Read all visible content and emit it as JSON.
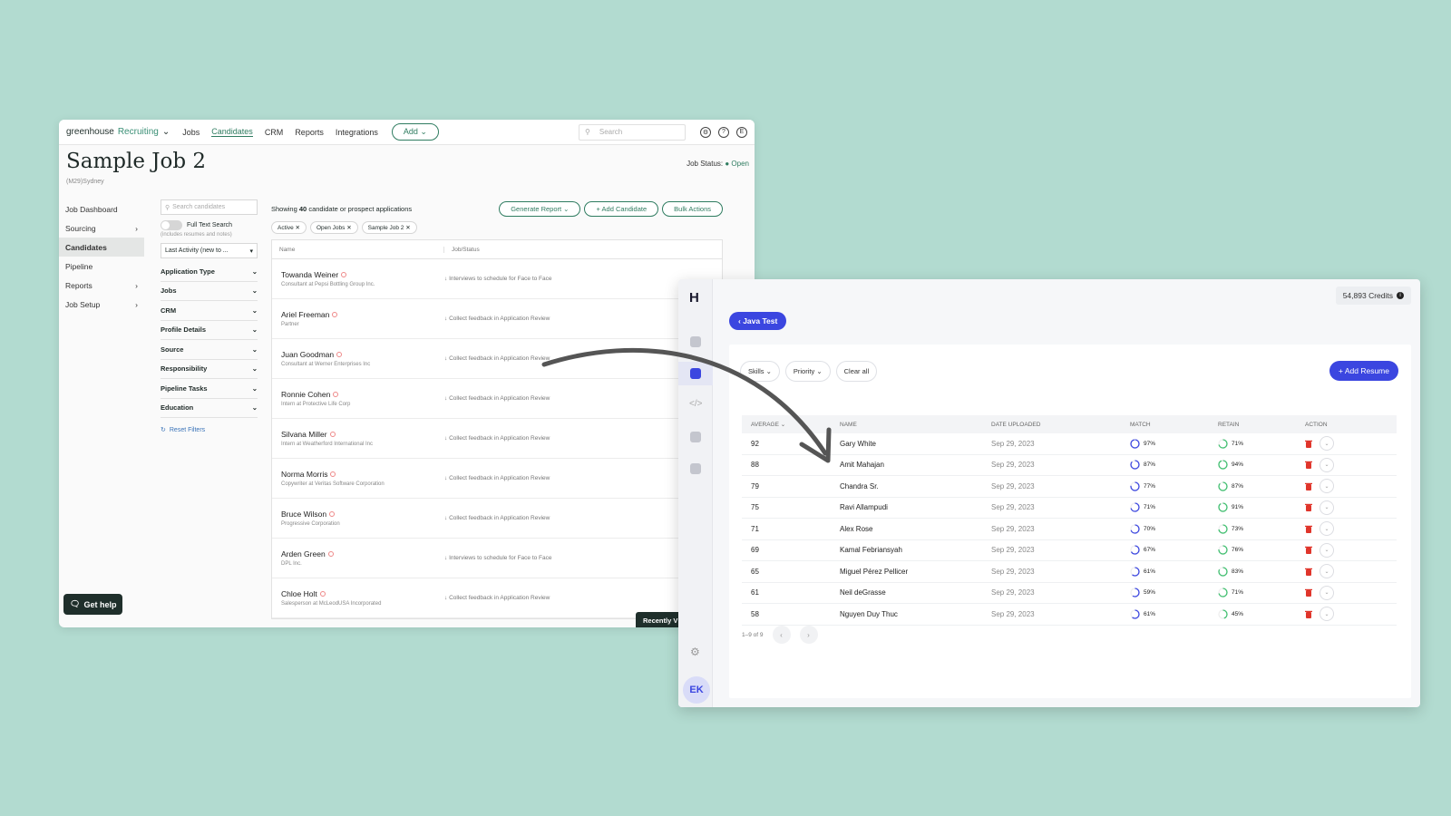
{
  "greenhouse": {
    "logo": "greenhouse",
    "logo_suffix": "Recruiting",
    "nav": [
      "Jobs",
      "Candidates",
      "CRM",
      "Reports",
      "Integrations"
    ],
    "add_button": "Add",
    "search_placeholder": "Search",
    "job_title": "Sample Job 2",
    "job_sub": "(M29)Sydney",
    "job_status_label": "Job Status:",
    "job_status_value": "Open",
    "left_nav": [
      {
        "label": "Job Dashboard",
        "arrow": false
      },
      {
        "label": "Sourcing",
        "arrow": true
      },
      {
        "label": "Candidates",
        "arrow": false
      },
      {
        "label": "Pipeline",
        "arrow": false
      },
      {
        "label": "Reports",
        "arrow": true
      },
      {
        "label": "Job Setup",
        "arrow": true
      }
    ],
    "filter_search_placeholder": "Search candidates",
    "full_text_search": "Full Text Search",
    "full_text_note": "(includes resumes and notes)",
    "sort_label": "Last Activity (new to ...",
    "filter_groups": [
      "Application Type",
      "Jobs",
      "CRM",
      "Profile Details",
      "Source",
      "Responsibility",
      "Pipeline Tasks",
      "Education"
    ],
    "reset_filters": "Reset Filters",
    "showing_prefix": "Showing",
    "showing_count": "40",
    "showing_suffix": "candidate or prospect applications",
    "generate_report": "Generate Report",
    "add_candidate": "+ Add Candidate",
    "bulk_actions": "Bulk Actions",
    "chips": [
      "Active",
      "Open Jobs",
      "Sample Job 2"
    ],
    "col_name": "Name",
    "col_job": "Job/Status",
    "candidates": [
      {
        "name": "Towanda Weiner",
        "company": "Consultant at Pepsi Bottling Group Inc.",
        "status": "Interviews to schedule for Face to Face"
      },
      {
        "name": "Ariel Freeman",
        "company": "Partner",
        "status": "Collect feedback in Application Review"
      },
      {
        "name": "Juan Goodman",
        "company": "Consultant at Werner Enterprises Inc",
        "status": "Collect feedback in Application Review"
      },
      {
        "name": "Ronnie Cohen",
        "company": "Intern at Protective Life Corp",
        "status": "Collect feedback in Application Review"
      },
      {
        "name": "Silvana Miller",
        "company": "Intern at Weatherford International Inc",
        "status": "Collect feedback in Application Review"
      },
      {
        "name": "Norma Morris",
        "company": "Copywriter at Veritas Software Corporation",
        "status": "Collect feedback in Application Review"
      },
      {
        "name": "Bruce Wilson",
        "company": "Progressive Corporation",
        "status": "Collect feedback in Application Review"
      },
      {
        "name": "Arden Green",
        "company": "DPL Inc.",
        "status": "Interviews to schedule for Face to Face"
      },
      {
        "name": "Chloe Holt",
        "company": "Salesperson at McLeodUSA Incorporated",
        "status": "Collect feedback in Application Review"
      }
    ],
    "get_help": "Get help",
    "recently_viewed": "Recently V"
  },
  "panel": {
    "logo": "H",
    "credits": "54,893 Credits",
    "back_button": "Java Test",
    "filters": [
      "Skills",
      "Priority"
    ],
    "clear_all": "Clear all",
    "add_resume": "+ Add Resume",
    "columns": [
      "AVERAGE",
      "NAME",
      "DATE UPLOADED",
      "MATCH",
      "RETAIN",
      "ACTION"
    ],
    "rows": [
      {
        "average": "92",
        "name": "Gary White",
        "date": "Sep 29, 2023",
        "match": "97%",
        "retain": "71%"
      },
      {
        "average": "88",
        "name": "Amit Mahajan",
        "date": "Sep 29, 2023",
        "match": "87%",
        "retain": "94%"
      },
      {
        "average": "79",
        "name": "Chandra Sr.",
        "date": "Sep 29, 2023",
        "match": "77%",
        "retain": "87%"
      },
      {
        "average": "75",
        "name": "Ravi Allampudi",
        "date": "Sep 29, 2023",
        "match": "71%",
        "retain": "91%"
      },
      {
        "average": "71",
        "name": "Alex Rose",
        "date": "Sep 29, 2023",
        "match": "70%",
        "retain": "73%"
      },
      {
        "average": "69",
        "name": "Kamal Febriansyah",
        "date": "Sep 29, 2023",
        "match": "67%",
        "retain": "76%"
      },
      {
        "average": "65",
        "name": "Miguel Pérez Pellicer",
        "date": "Sep 29, 2023",
        "match": "61%",
        "retain": "83%"
      },
      {
        "average": "61",
        "name": "Neil deGrasse",
        "date": "Sep 29, 2023",
        "match": "59%",
        "retain": "71%"
      },
      {
        "average": "58",
        "name": "Nguyen Duy Thuc",
        "date": "Sep 29, 2023",
        "match": "61%",
        "retain": "45%"
      }
    ],
    "pagination": "1–9 of 9",
    "avatar": "EK",
    "colors": {
      "accent": "#3b46e0",
      "retain": "#3fbf6f",
      "trash": "#e0352b"
    }
  }
}
